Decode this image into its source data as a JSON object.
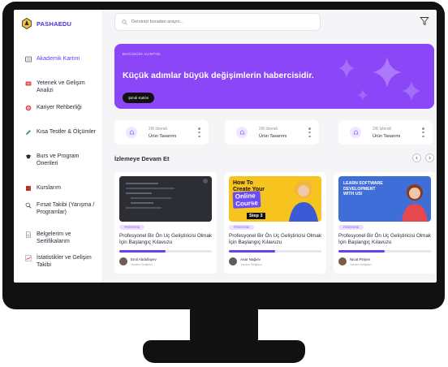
{
  "app": {
    "brand": "PASHAEDU"
  },
  "sidebar": {
    "items": [
      {
        "label": "Akademik Kartım",
        "icon": "id-card-icon",
        "active": true
      },
      {
        "label": "Yetenek ve Gelişim Analizi",
        "icon": "chart-icon"
      },
      {
        "label": "Kariyer Rehberliği",
        "icon": "target-icon"
      },
      {
        "label": "Kısa Testler & Ölçümler",
        "icon": "pencil-icon"
      },
      {
        "label": "Burs ve Program Önerileri",
        "icon": "graduation-cap-icon"
      },
      {
        "label": "Kurslarım",
        "icon": "book-icon"
      },
      {
        "label": "Fırsat Takibi (Yarışma / Programlar)",
        "icon": "search-icon"
      },
      {
        "label": "Belgelerim ve Sertifikalarım",
        "icon": "document-icon"
      },
      {
        "label": "İstatistikler ve Gelişim Takibi",
        "icon": "stats-icon"
      }
    ]
  },
  "search": {
    "placeholder": "Dersinizi buradan arayın..."
  },
  "banner": {
    "kicker": "BUGÜNÜN ALINTISI",
    "headline": "Küçük adımlar büyük değişimlerin habercisidir.",
    "cta": "Şimdi Katılın"
  },
  "stats": [
    {
      "count": "2/8 İzlendi",
      "title": "Ürün Tasarımı"
    },
    {
      "count": "2/8 İzlendi",
      "title": "Ürün Tasarımı"
    },
    {
      "count": "2/8 İzlendi",
      "title": "Ürün Tasarımı"
    }
  ],
  "continue_section": {
    "title": "İzlemeye Devam Et"
  },
  "courses": [
    {
      "tag": "FRONTEND",
      "title": "Profesyonel Bir Ön Uç Geliştiricisi Olmak İçin Başlangıç Kılavuzu",
      "author": "Emil Abdullayev",
      "role": "Yazılım Geliştirici",
      "progress": 0.5,
      "thumb": {
        "kind": "code-editor"
      }
    },
    {
      "tag": "FRONTEND",
      "title": "Profesyonel Bir Ön Uç Geliştiricisi Olmak İçin Başlangıç Kılavuzu",
      "author": "Anar Nağıev",
      "role": "Yazılım Geliştirici",
      "progress": 0.5,
      "thumb": {
        "line1": "How To",
        "line2": "Create Your",
        "highlight1": "Online",
        "highlight2": "Course",
        "badge": "Step 3"
      }
    },
    {
      "tag": "FRONTEND",
      "title": "Profesyonel Bir Ön Uç Geliştiricisi Olmak İçin Başlangıç Kılavuzu",
      "author": "Nicat Piriyev",
      "role": "Yazılım Geliştirici",
      "progress": 0.5,
      "thumb": {
        "line1": "LEARN SOFTWARE",
        "line2": "DEVELOPMENT",
        "line3": "WITH US!"
      }
    }
  ],
  "colors": {
    "accent": "#6a3cf0",
    "banner": "#8b46f7",
    "bezel": "#111111"
  }
}
